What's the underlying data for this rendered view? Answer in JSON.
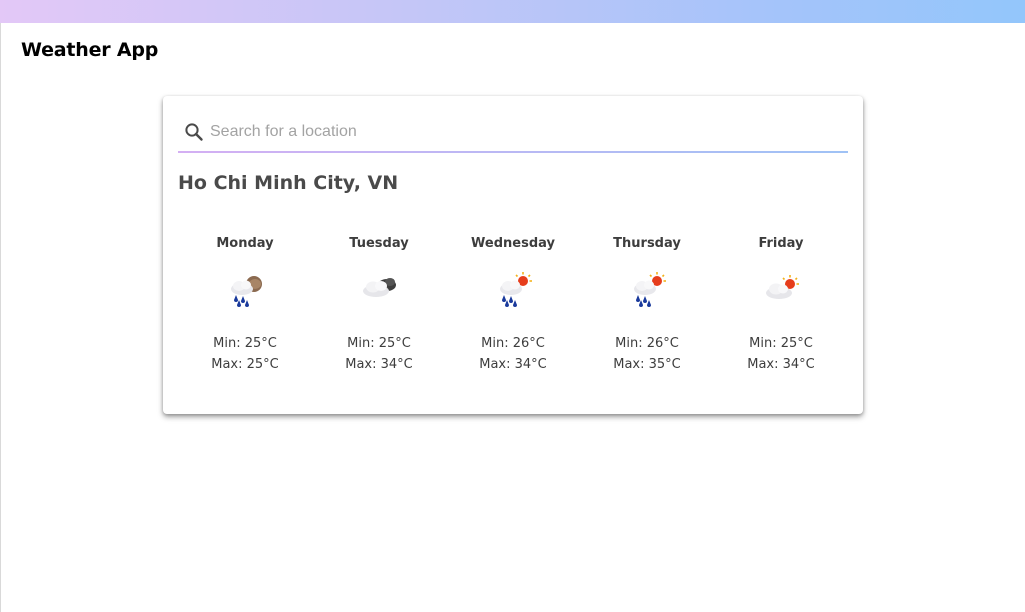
{
  "app": {
    "title": "Weather App"
  },
  "theme": {
    "gradient_start": "#e3c8f7",
    "gradient_end": "#93c6fb",
    "text": "#3d3d3d"
  },
  "search": {
    "placeholder": "Search for a location",
    "value": "",
    "icon": "search-icon"
  },
  "location": {
    "name": "Ho Chi Minh City, VN"
  },
  "forecast": [
    {
      "day": "Monday",
      "icon": "rain-cloudy-night-icon",
      "min": "Min: 25°C",
      "max": "Max: 25°C"
    },
    {
      "day": "Tuesday",
      "icon": "cloudy-night-icon",
      "min": "Min: 25°C",
      "max": "Max: 34°C"
    },
    {
      "day": "Wednesday",
      "icon": "rain-sun-icon",
      "min": "Min: 26°C",
      "max": "Max: 34°C"
    },
    {
      "day": "Thursday",
      "icon": "rain-sun-icon",
      "min": "Min: 26°C",
      "max": "Max: 35°C"
    },
    {
      "day": "Friday",
      "icon": "partly-cloudy-sun-icon",
      "min": "Min: 25°C",
      "max": "Max: 34°C"
    }
  ]
}
